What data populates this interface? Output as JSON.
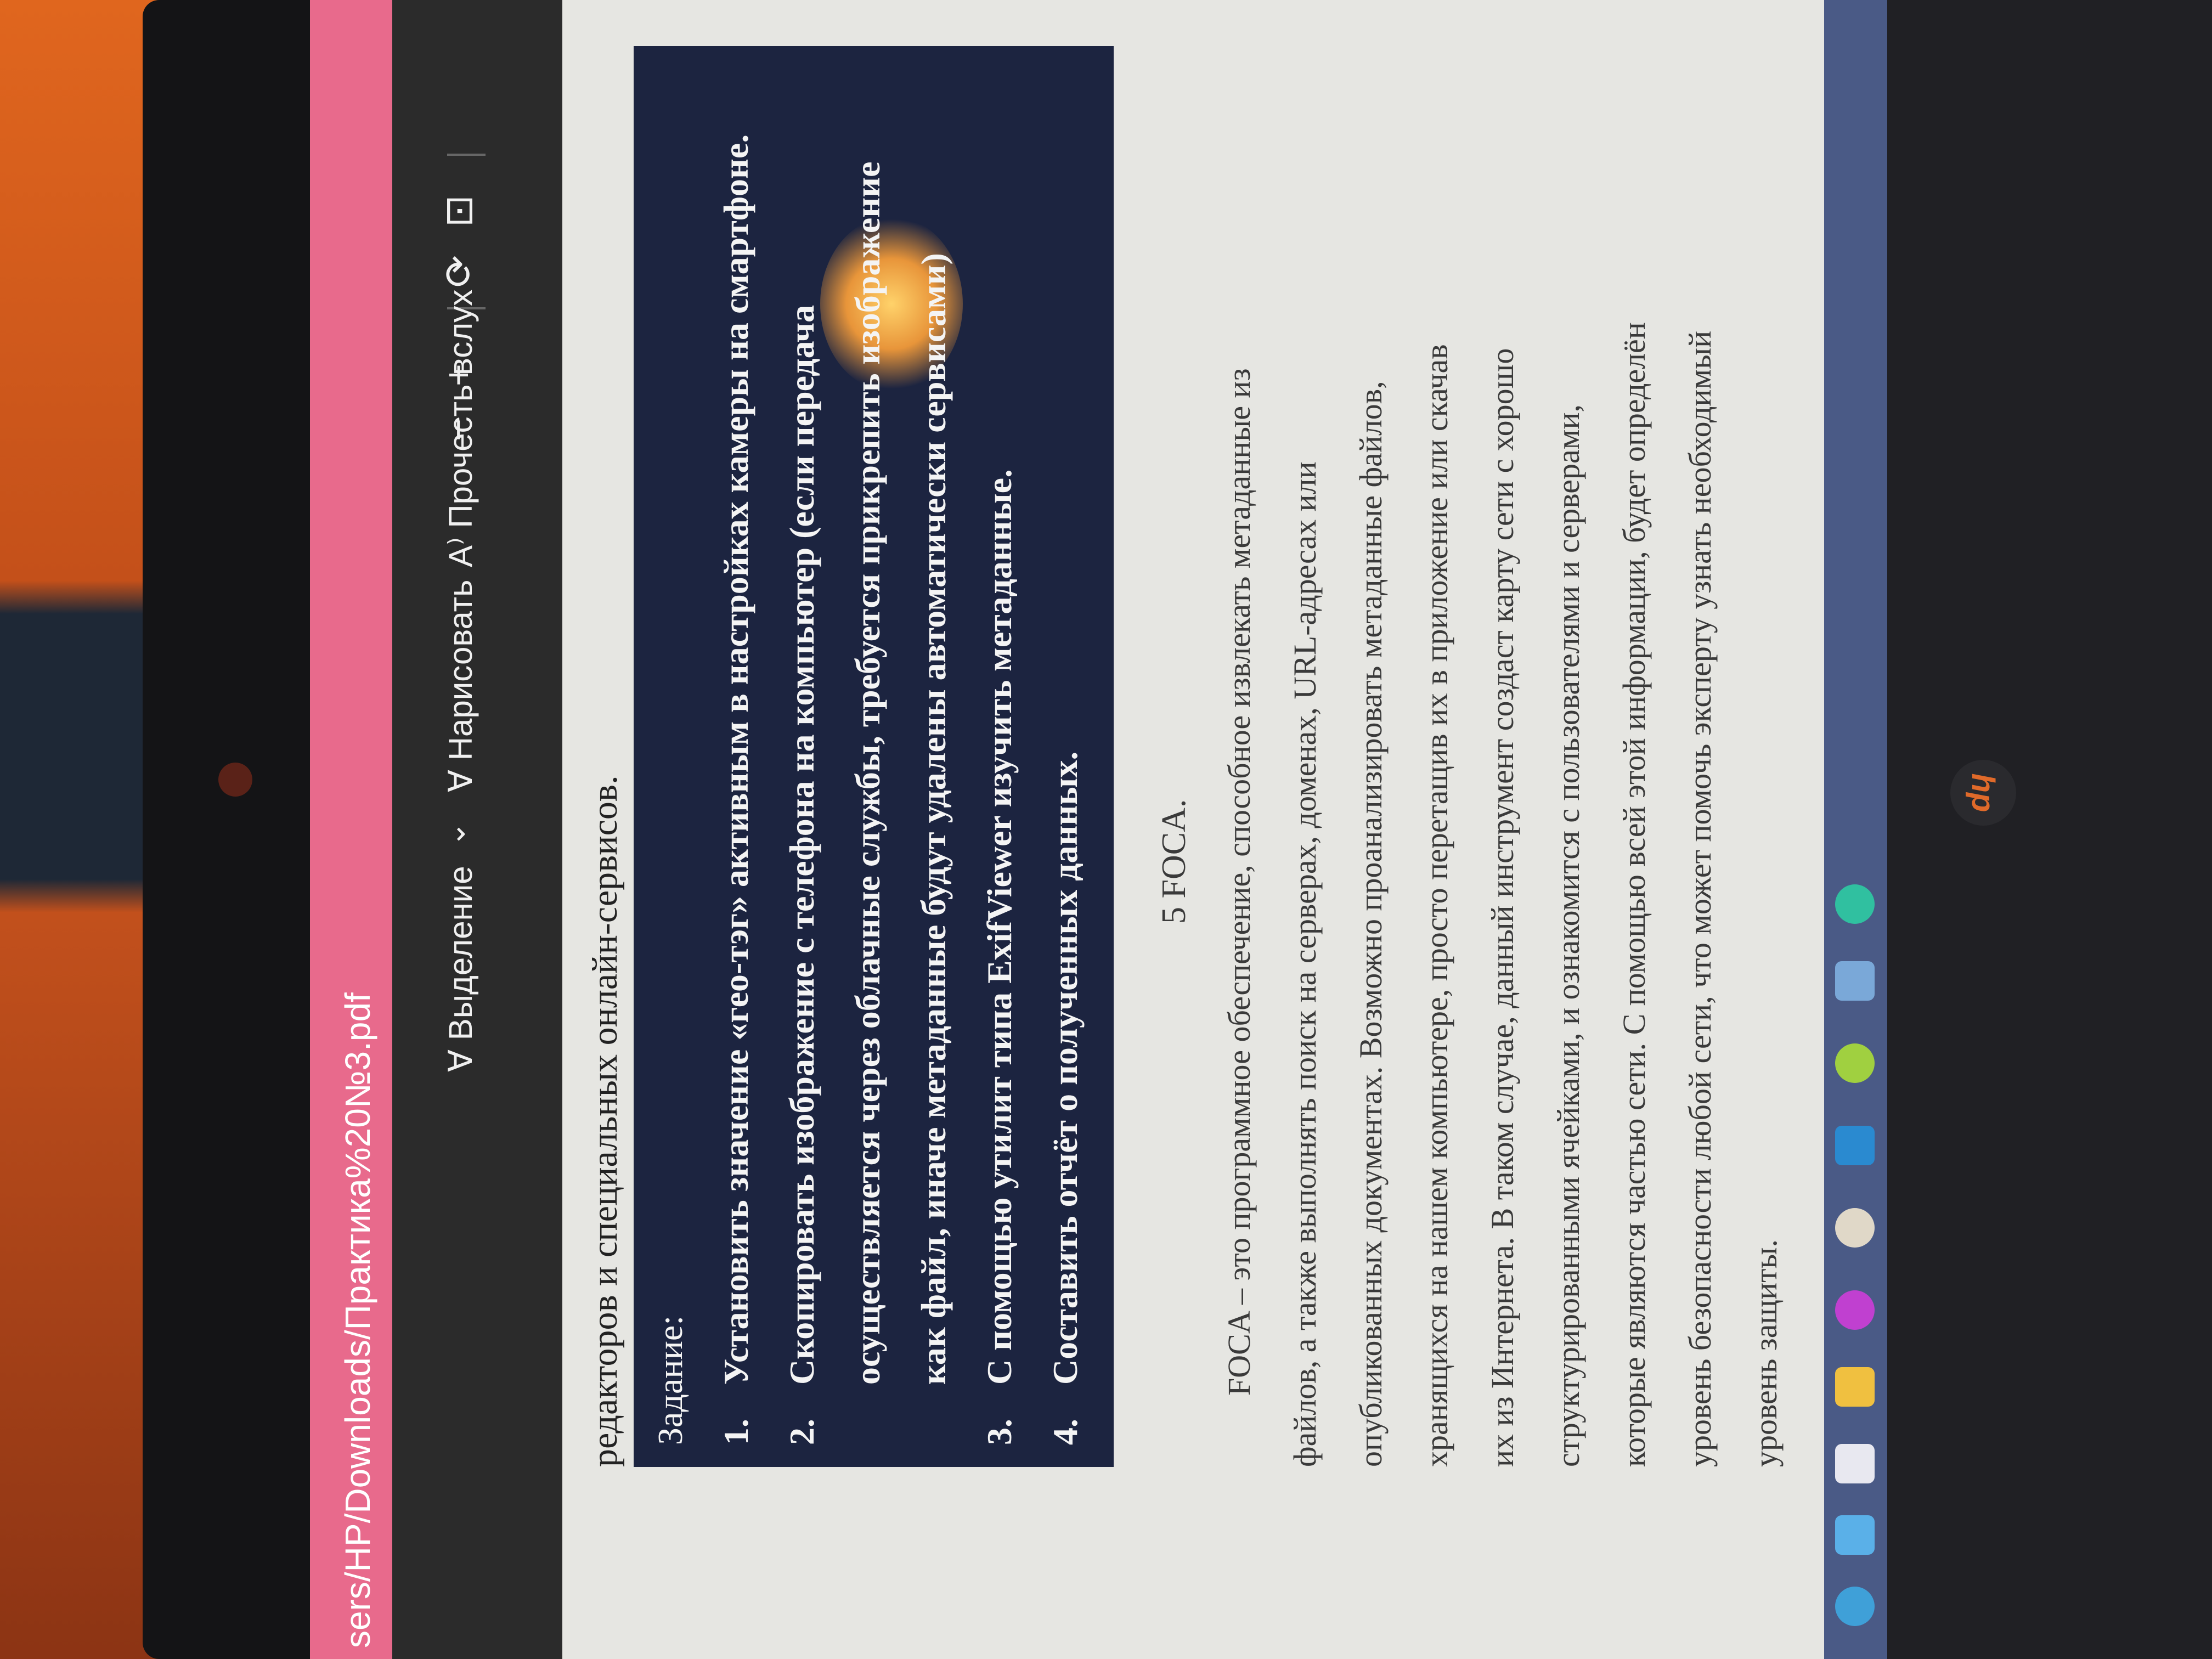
{
  "window": {
    "file_path": "sers/HP/Downloads/Практика%20№3.pdf"
  },
  "toolbar": {
    "zoom_out": "−",
    "zoom_in": "+",
    "rotate_icon": "rotate-icon",
    "fit_icon": "fit-page-icon",
    "read_aloud": "Прочесть вслух",
    "draw": "Нарисовать",
    "highlight": "Выделение"
  },
  "document": {
    "intro_line": "редакторов и специальных онлайн-сервисов.",
    "task_title": "Задание:",
    "tasks": [
      {
        "num": "1.",
        "text": "Установить значение «гео-тэг» активным в настройках камеры на смартфоне."
      },
      {
        "num": "2.",
        "text": "Скопировать изображение с телефона на компьютер (если передача"
      },
      {
        "num": "",
        "text": "осуществляется через облачные службы, требуется прикрепить изображение"
      },
      {
        "num": "",
        "text": "как файл, иначе метаданные будут удалены автоматически сервисами)"
      },
      {
        "num": "3.",
        "text": "С помощью утилит типа ExifViewer изучить метаданные."
      },
      {
        "num": "4.",
        "text": "Составить отчёт о полученных данных."
      }
    ],
    "section_heading": "5 FOCA.",
    "paragraph_lines": [
      "FOCA – это программное обеспечение, способное извлекать метаданные из",
      "файлов, а также выполнять поиск на серверах, доменах, URL-адресах или",
      "опубликованных документах. Возможно проанализировать метаданные файлов,",
      "хранящихся на нашем компьютере, просто перетащив их в приложение или скачав",
      "их из Интернета. В таком случае, данный инструмент создаст карту сети с хорошо",
      "структурированными ячейками, и ознакомится с пользователями и серверами,",
      "которые являются частью сети. С помощью всей этой информации, будет определён",
      "уровень безопасности любой сети, что может помочь эксперту узнать необходимый",
      "уровень защиты."
    ]
  },
  "taskbar": {
    "icons": [
      "start-icon",
      "widgets-icon",
      "file-explorer-icon",
      "app-icon-1",
      "app-icon-2",
      "app-icon-3",
      "app-icon-4",
      "app-icon-5",
      "app-icon-6",
      "edge-icon"
    ]
  },
  "hardware": {
    "brand": "hp"
  }
}
